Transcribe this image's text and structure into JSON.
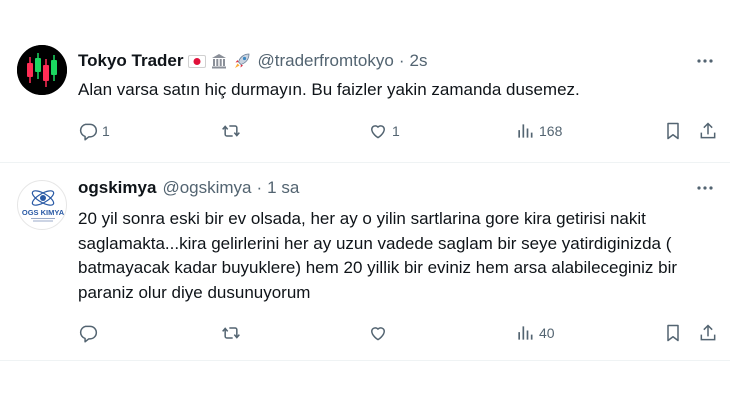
{
  "tweets": [
    {
      "author_name": "Tokyo Trader",
      "badges": [
        "🇯🇵",
        "🏛️",
        "🚀"
      ],
      "handle": "@traderfromtokyo",
      "separator": "·",
      "time": "2s",
      "text": "Alan varsa satın hiç durmayın. Bu faizler yakin zamanda dusemez.",
      "reply_count": "1",
      "retweet_count": "",
      "like_count": "1",
      "view_count": "168",
      "avatar_icon": "candlestick-chart-icon"
    },
    {
      "author_name": "ogskimya",
      "handle": "@ogskimya",
      "separator": "·",
      "time": "1 sa",
      "text": "20 yil sonra eski bir ev olsada,  her ay o yilin sartlarina gore kira getirisi nakit saglamakta...kira gelirlerini her ay uzun vadede saglam bir seye yatirdiginizda ( batmayacak kadar buyuklere) hem 20 yillik bir eviniz hem arsa alabileceginiz bir paraniz olur diye dusunuyorum",
      "reply_count": "",
      "retweet_count": "",
      "like_count": "",
      "view_count": "40",
      "avatar_logo_text": "OGS KIMYA"
    }
  ],
  "colors": {
    "text_primary": "#0f1419",
    "text_secondary": "#536471",
    "divider": "#eff3f4",
    "candle_green": "#1bd760",
    "candle_red": "#ff2d55"
  }
}
